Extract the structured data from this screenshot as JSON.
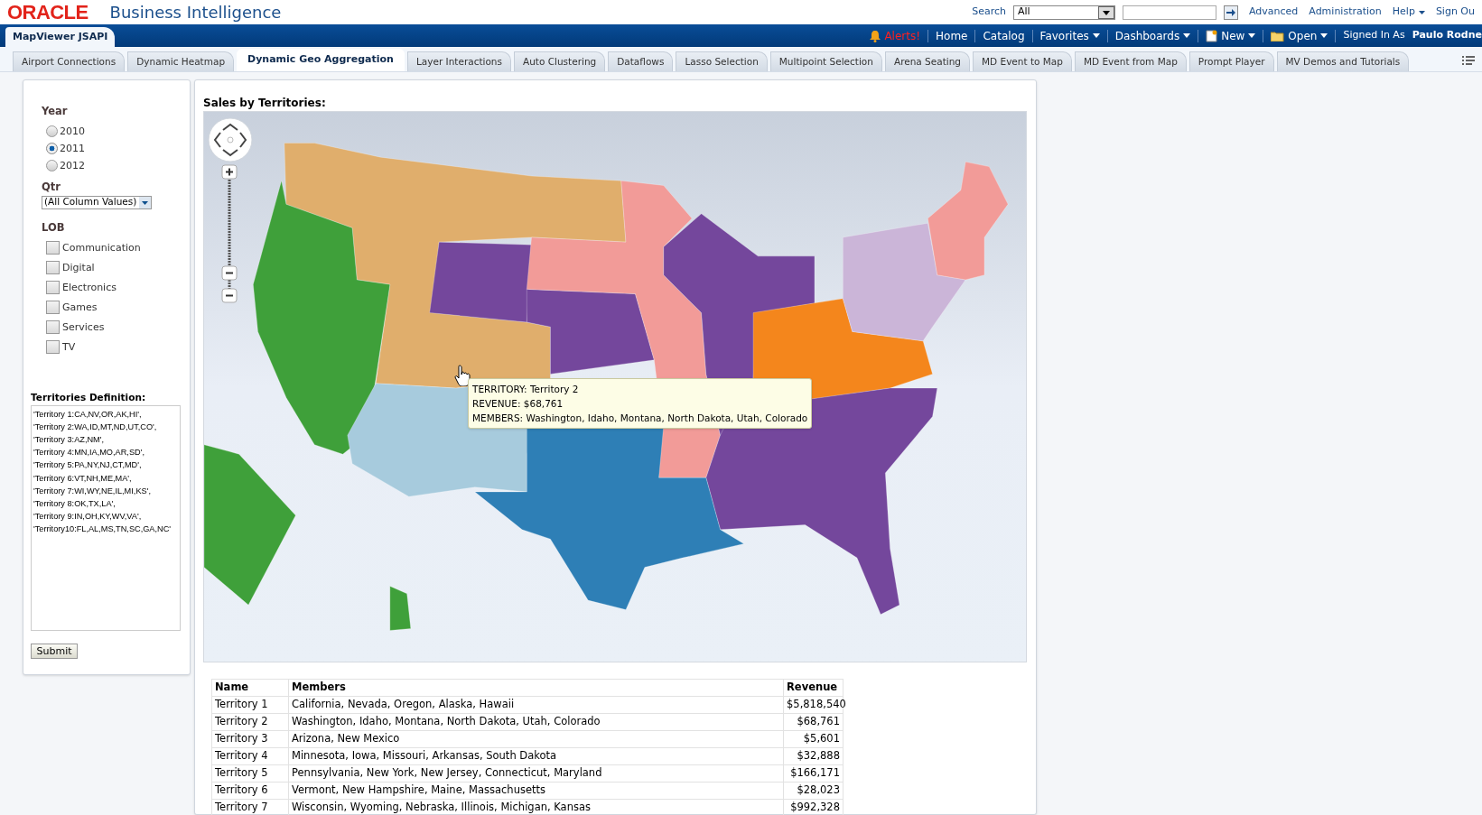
{
  "header": {
    "logo": "ORACLE",
    "product": "Business Intelligence",
    "search_label": "Search",
    "search_scope": "All",
    "links": [
      "Advanced",
      "Administration",
      "Help",
      "Sign Ou"
    ]
  },
  "nav_bar": {
    "dashboard_title": "MapViewer JSAPI",
    "alerts": "Alerts!",
    "items": [
      {
        "label": "Home",
        "kind": "link"
      },
      {
        "label": "Catalog",
        "kind": "link"
      },
      {
        "label": "Favorites",
        "kind": "menu"
      },
      {
        "label": "Dashboards",
        "kind": "menu"
      },
      {
        "label": "New",
        "kind": "new"
      },
      {
        "label": "Open",
        "kind": "open"
      }
    ],
    "signed_in_label": "Signed In As",
    "user": "Paulo Rodne"
  },
  "tabs": [
    {
      "label": "Airport Connections",
      "selected": false
    },
    {
      "label": "Dynamic Heatmap",
      "selected": false
    },
    {
      "label": "Dynamic Geo Aggregation",
      "selected": true
    },
    {
      "label": "Layer Interactions",
      "selected": false
    },
    {
      "label": "Auto Clustering",
      "selected": false
    },
    {
      "label": "Dataflows",
      "selected": false
    },
    {
      "label": "Lasso Selection",
      "selected": false
    },
    {
      "label": "Multipoint Selection",
      "selected": false
    },
    {
      "label": "Arena Seating",
      "selected": false
    },
    {
      "label": "MD Event to Map",
      "selected": false
    },
    {
      "label": "MD Event from Map",
      "selected": false
    },
    {
      "label": "Prompt Player",
      "selected": false
    },
    {
      "label": "MV Demos and Tutorials",
      "selected": false
    }
  ],
  "prompts": {
    "year_label": "Year",
    "years": [
      {
        "label": "2010",
        "selected": false
      },
      {
        "label": "2011",
        "selected": true
      },
      {
        "label": "2012",
        "selected": false
      }
    ],
    "qtr_label": "Qtr",
    "qtr_value": "(All Column Values)",
    "lob_label": "LOB",
    "lob": [
      {
        "label": "Communication",
        "checked": false
      },
      {
        "label": "Digital",
        "checked": false
      },
      {
        "label": "Electronics",
        "checked": false
      },
      {
        "label": "Games",
        "checked": false
      },
      {
        "label": "Services",
        "checked": false
      },
      {
        "label": "TV",
        "checked": false
      }
    ],
    "definition_label": "Territories Definition:",
    "definition_value": "'Territory 1:CA,NV,OR,AK,HI',\n'Territory 2:WA,ID,MT,ND,UT,CO',\n'Territory 3:AZ,NM',\n'Territory 4:MN,IA,MO,AR,SD',\n'Territory 5:PA,NY,NJ,CT,MD',\n'Territory 6:VT,NH,ME,MA',\n'Territory 7:WI,WY,NE,IL,MI,KS',\n'Territory 8:OK,TX,LA',\n'Territory 9:IN,OH,KY,WV,VA',\n'Territory10:FL,AL,MS,TN,SC,GA,NC'",
    "submit": "Submit"
  },
  "map": {
    "title": "Sales by Territories:",
    "tooltip": [
      "TERRITORY: Territory 2",
      "REVENUE: $68,761",
      "MEMBERS: Washington, Idaho, Montana, North Dakota, Utah, Colorado"
    ]
  },
  "table": {
    "columns": [
      "Name",
      "Members",
      "Revenue"
    ],
    "rows": [
      [
        "Territory 1",
        "California, Nevada, Oregon, Alaska, Hawaii",
        "$5,818,540"
      ],
      [
        "Territory 2",
        "Washington, Idaho, Montana, North Dakota, Utah, Colorado",
        "$68,761"
      ],
      [
        "Territory 3",
        "Arizona, New Mexico",
        "$5,601"
      ],
      [
        "Territory 4",
        "Minnesota, Iowa, Missouri, Arkansas, South Dakota",
        "$32,888"
      ],
      [
        "Territory 5",
        "Pennsylvania, New York, New Jersey, Connecticut, Maryland",
        "$166,171"
      ],
      [
        "Territory 6",
        "Vermont, New Hampshire, Maine, Massachusetts",
        "$28,023"
      ],
      [
        "Territory 7",
        "Wisconsin, Wyoming, Nebraska, Illinois, Michigan, Kansas",
        "$992,328"
      ]
    ]
  }
}
